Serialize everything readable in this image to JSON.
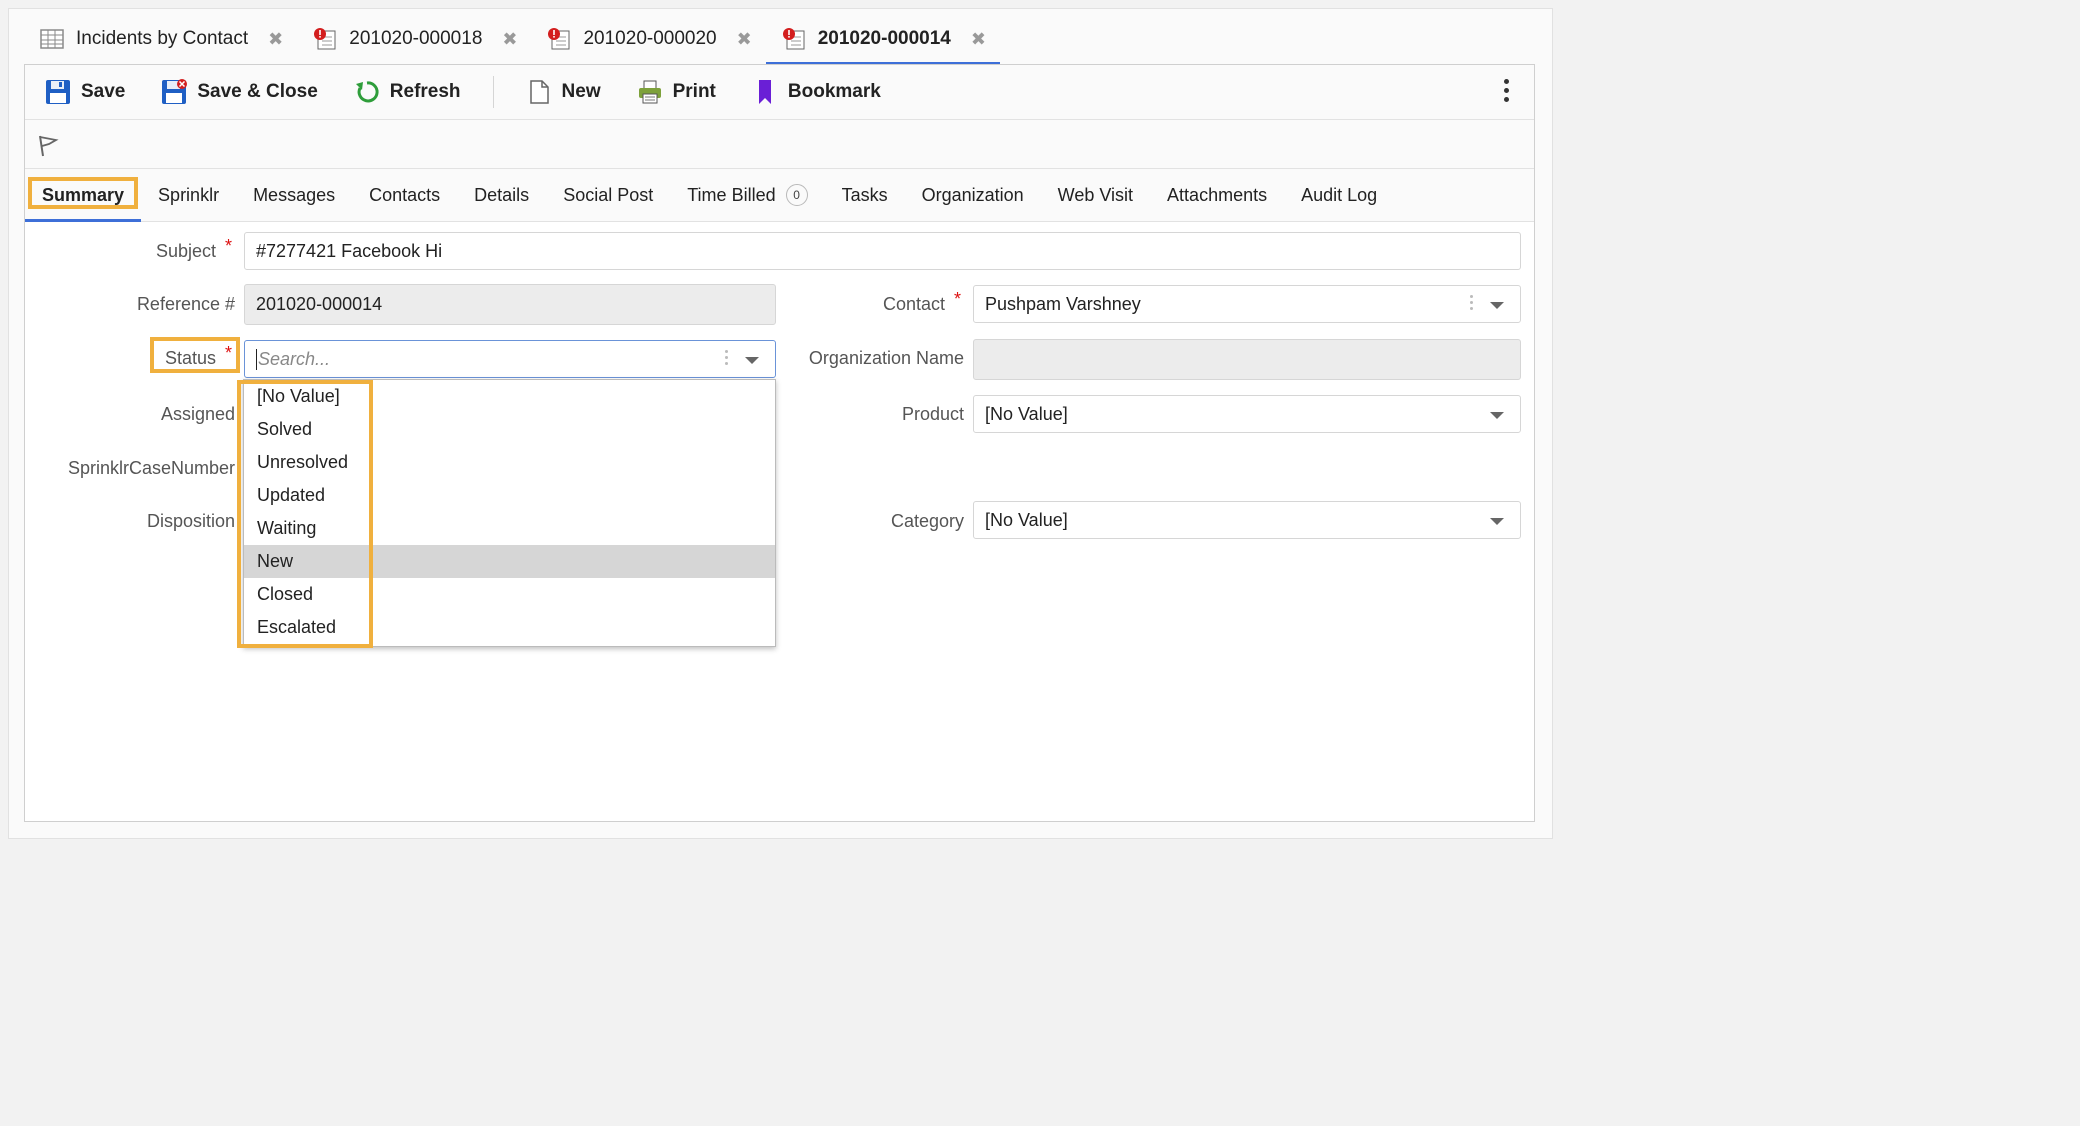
{
  "doc_tabs": [
    {
      "label": "Incidents by Contact",
      "icon": "grid-icon",
      "active": false
    },
    {
      "label": "201020-000018",
      "icon": "incident-icon",
      "active": false
    },
    {
      "label": "201020-000020",
      "icon": "incident-icon",
      "active": false
    },
    {
      "label": "201020-000014",
      "icon": "incident-icon",
      "active": true
    }
  ],
  "close_glyph": "✖",
  "toolbar": {
    "save": "Save",
    "save_close": "Save & Close",
    "refresh": "Refresh",
    "new": "New",
    "print": "Print",
    "bookmark": "Bookmark"
  },
  "subtabs": {
    "summary": "Summary",
    "sprinklr": "Sprinklr",
    "messages": "Messages",
    "contacts": "Contacts",
    "details": "Details",
    "social_post": "Social Post",
    "time_billed": "Time Billed",
    "time_billed_count": "0",
    "tasks": "Tasks",
    "organization": "Organization",
    "web_visit": "Web Visit",
    "attachments": "Attachments",
    "audit_log": "Audit Log"
  },
  "form": {
    "subject_label": "Subject",
    "subject_value": "#7277421 Facebook Hi",
    "reference_label": "Reference #",
    "reference_value": "201020-000014",
    "status_label": "Status",
    "status_placeholder": "Search...",
    "assigned_label": "Assigned",
    "sprinklr_case_label": "SprinklrCaseNumber",
    "disposition_label": "Disposition",
    "contact_label": "Contact",
    "contact_value": "Pushpam Varshney",
    "org_name_label": "Organization Name",
    "product_label": "Product",
    "product_value": "[No Value]",
    "category_label": "Category",
    "category_value": "[No Value]",
    "required_mark": "*"
  },
  "status_options": [
    "[No Value]",
    "Solved",
    "Unresolved",
    "Updated",
    "Waiting",
    "New",
    "Closed",
    "Escalated"
  ],
  "colors": {
    "highlight": "#f0b03e",
    "accent": "#3d6fd8",
    "required": "#dd1111",
    "bookmark": "#6a1fd6"
  }
}
